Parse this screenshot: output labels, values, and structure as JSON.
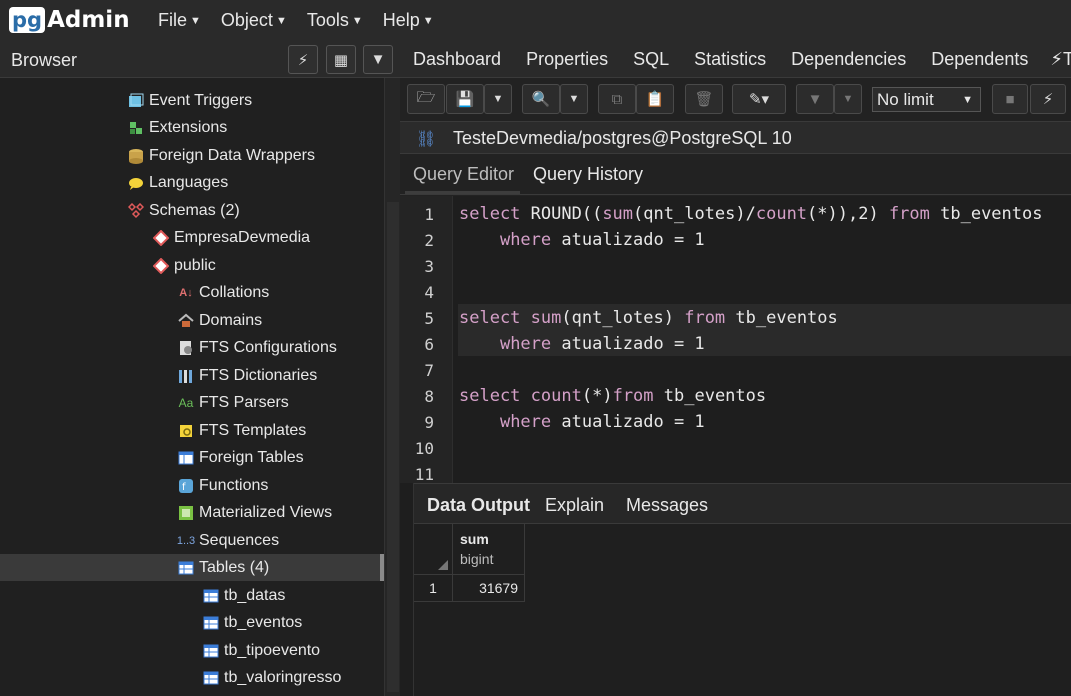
{
  "app": {
    "logo_pg": "pg",
    "logo_admin": "Admin",
    "menu": [
      "File",
      "Object",
      "Tools",
      "Help"
    ]
  },
  "browser": {
    "title": "Browser",
    "tree": [
      {
        "label": "Event Triggers",
        "icon": "event-triggers-icon"
      },
      {
        "label": "Extensions",
        "icon": "extensions-icon"
      },
      {
        "label": "Foreign Data Wrappers",
        "icon": "foreign-data-wrappers-icon"
      },
      {
        "label": "Languages",
        "icon": "languages-icon"
      },
      {
        "label": "Schemas (2)",
        "icon": "schemas-icon"
      },
      {
        "label": "EmpresaDevmedia",
        "icon": "schema-icon"
      },
      {
        "label": "public",
        "icon": "schema-icon"
      },
      {
        "label": "Collations",
        "icon": "collations-icon"
      },
      {
        "label": "Domains",
        "icon": "domains-icon"
      },
      {
        "label": "FTS Configurations",
        "icon": "fts-configurations-icon"
      },
      {
        "label": "FTS Dictionaries",
        "icon": "fts-dictionaries-icon"
      },
      {
        "label": "FTS Parsers",
        "icon": "fts-parsers-icon"
      },
      {
        "label": "FTS Templates",
        "icon": "fts-templates-icon"
      },
      {
        "label": "Foreign Tables",
        "icon": "foreign-tables-icon"
      },
      {
        "label": "Functions",
        "icon": "functions-icon"
      },
      {
        "label": "Materialized Views",
        "icon": "materialized-views-icon"
      },
      {
        "label": "Sequences",
        "icon": "sequences-icon"
      },
      {
        "label": "Tables (4)",
        "icon": "tables-icon"
      },
      {
        "label": "tb_datas",
        "icon": "table-icon"
      },
      {
        "label": "tb_eventos",
        "icon": "table-icon"
      },
      {
        "label": "tb_tipoevento",
        "icon": "table-icon"
      },
      {
        "label": "tb_valoringresso",
        "icon": "table-icon"
      }
    ]
  },
  "tabs": [
    "Dashboard",
    "Properties",
    "SQL",
    "Statistics",
    "Dependencies",
    "Dependents",
    "Tes"
  ],
  "toolbar": {
    "limit_value": "No limit"
  },
  "connection": {
    "text": "TesteDevmedia/postgres@PostgreSQL 10"
  },
  "query_tabs": {
    "editor": "Query Editor",
    "history": "Query History"
  },
  "editor": {
    "line_numbers": [
      "1",
      "2",
      "3",
      "4",
      "5",
      "6",
      "7",
      "8",
      "9",
      "10",
      "11"
    ],
    "lines": [
      "select ROUND((sum(qnt_lotes)/count(*)),2) from tb_eventos",
      "    where atualizado = 1",
      "",
      "",
      "select sum(qnt_lotes) from tb_eventos",
      "    where atualizado = 1",
      "",
      "select count(*)from tb_eventos",
      "    where atualizado = 1",
      "",
      ""
    ]
  },
  "results": {
    "tabs": [
      "Data Output",
      "Explain",
      "Messages"
    ],
    "column_name": "sum",
    "column_type": "bigint",
    "row_number": "1",
    "value": "31679"
  }
}
